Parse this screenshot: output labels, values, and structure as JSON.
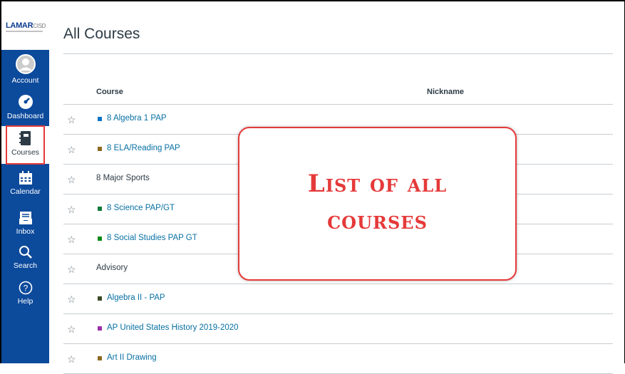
{
  "logo": {
    "text": "LAMAR",
    "suffix": "CISD"
  },
  "nav": [
    {
      "id": "account",
      "label": "Account",
      "icon": "avatar-icon",
      "active": false
    },
    {
      "id": "dashboard",
      "label": "Dashboard",
      "icon": "dashboard-icon",
      "active": false
    },
    {
      "id": "courses",
      "label": "Courses",
      "icon": "courses-icon",
      "active": true
    },
    {
      "id": "calendar",
      "label": "Calendar",
      "icon": "calendar-icon",
      "active": false
    },
    {
      "id": "inbox",
      "label": "Inbox",
      "icon": "inbox-icon",
      "active": false
    },
    {
      "id": "search",
      "label": "Search",
      "icon": "search-icon",
      "active": false
    },
    {
      "id": "help",
      "label": "Help",
      "icon": "help-icon",
      "active": false
    }
  ],
  "page": {
    "title": "All Courses"
  },
  "table": {
    "headers": {
      "course": "Course",
      "nickname": "Nickname"
    },
    "rows": [
      {
        "name": "8 Algebra 1 PAP",
        "color": "#0b74c7",
        "linked": true
      },
      {
        "name": "8 ELA/Reading PAP",
        "color": "#8c6a22",
        "linked": true
      },
      {
        "name": "8 Major Sports",
        "color": null,
        "linked": false
      },
      {
        "name": "8 Science PAP/GT",
        "color": "#0f7a3a",
        "linked": true
      },
      {
        "name": "8 Social Studies PAP GT",
        "color": "#0a8a18",
        "linked": true
      },
      {
        "name": "Advisory",
        "color": null,
        "linked": false
      },
      {
        "name": "Algebra II - PAP",
        "color": "#3b4a25",
        "linked": true
      },
      {
        "name": "AP United States History 2019-2020",
        "color": "#9a2fa8",
        "linked": true
      },
      {
        "name": "Art II Drawing",
        "color": "#8c6a22",
        "linked": true
      }
    ]
  },
  "callout": {
    "line1": "List of all",
    "line2": "courses"
  },
  "colors": {
    "nav_bg": "#0c4a9c",
    "link": "#0770a3",
    "annotation": "#e53a3a"
  }
}
